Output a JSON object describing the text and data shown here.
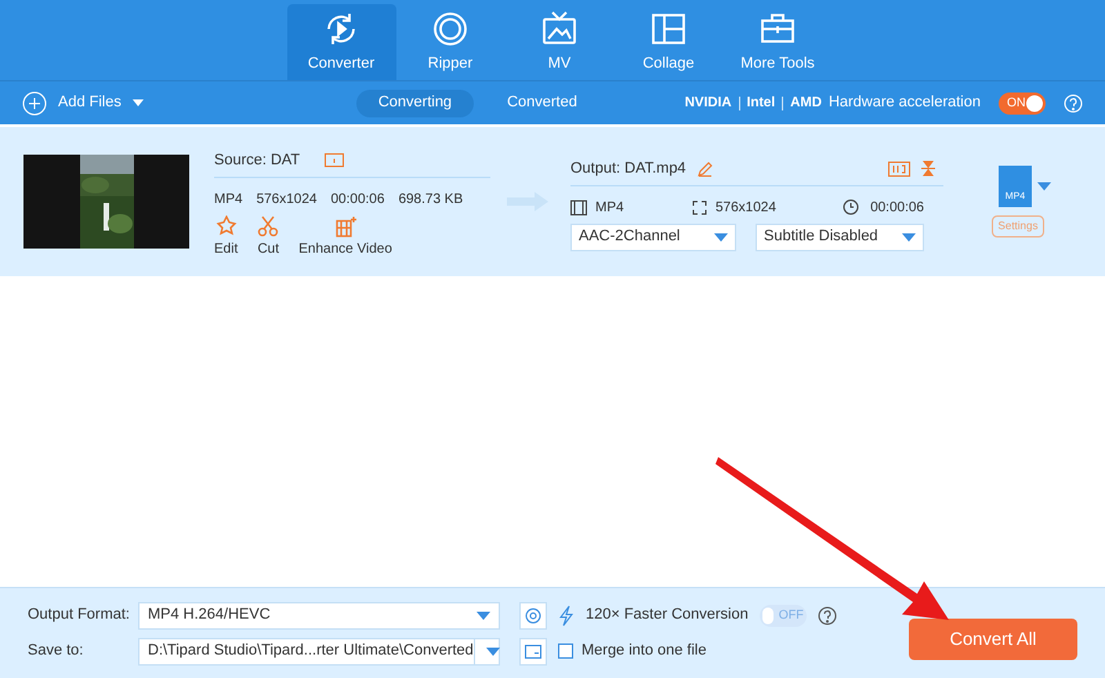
{
  "nav_tabs": [
    {
      "label": "Converter",
      "kind": "converter",
      "selected": true
    },
    {
      "label": "Ripper",
      "kind": "ripper",
      "selected": false
    },
    {
      "label": "MV",
      "kind": "mv",
      "selected": false
    },
    {
      "label": "Collage",
      "kind": "collage",
      "selected": false
    },
    {
      "label": "More Tools",
      "kind": "tools",
      "selected": false
    }
  ],
  "toolbar": {
    "add_files": "Add Files",
    "tabs": [
      {
        "label": "Converting",
        "selected": true
      },
      {
        "label": "Converted",
        "selected": false
      }
    ],
    "gpu": [
      "NVIDIA",
      "Intel",
      "AMD"
    ],
    "hw_label": "Hardware acceleration",
    "hw_toggle": {
      "label": "ON",
      "on": true
    }
  },
  "file": {
    "source": "Source: DAT",
    "format": "MP4",
    "resolution": "576x1024",
    "duration": "00:00:06",
    "size": "698.73 KB",
    "actions": [
      {
        "label": "Edit",
        "kind": "edit"
      },
      {
        "label": "Cut",
        "kind": "cut"
      },
      {
        "label": "Enhance Video",
        "kind": "enhance"
      }
    ],
    "output": "Output: DAT.mp4",
    "out_format": "MP4",
    "out_resolution": "576x1024",
    "out_duration": "00:00:06",
    "audio": "AAC-2Channel",
    "subtitle": "Subtitle Disabled",
    "format_badge": "MP4",
    "settings": "Settings"
  },
  "bottom": {
    "output_format_label": "Output Format:",
    "output_format": "MP4 H.264/HEVC",
    "save_to_label": "Save to:",
    "save_to": "D:\\Tipard Studio\\Tipard...rter Ultimate\\Converted",
    "faster": "120× Faster Conversion",
    "faster_toggle": {
      "label": "OFF",
      "on": false
    },
    "merge": {
      "label": "Merge into one file",
      "checked": false
    },
    "convert_all": "Convert All"
  }
}
